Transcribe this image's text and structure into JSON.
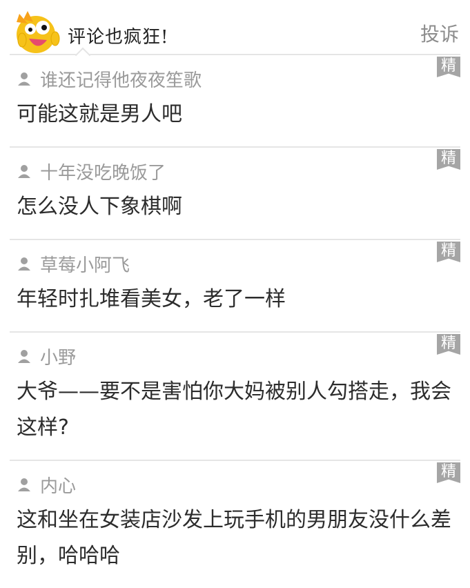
{
  "header": {
    "title": "评论也疯狂!",
    "report_label": "投诉"
  },
  "badge_label": "精",
  "comments": [
    {
      "user": "谁还记得他夜夜笙歌",
      "text": "可能这就是男人吧"
    },
    {
      "user": "十年没吃晚饭了",
      "text": "怎么没人下象棋啊"
    },
    {
      "user": "草莓小阿飞",
      "text": "年轻时扎堆看美女，老了一样"
    },
    {
      "user": "小野",
      "text": "大爷——要不是害怕你大妈被别人勾搭走，我会这样?"
    },
    {
      "user": "内心",
      "text": "这和坐在女装店沙发上玩手机的男朋友没什么差别，哈哈哈"
    }
  ],
  "colors": {
    "mascot": "#f6c21a",
    "badge": "#a5a5a5",
    "username": "#9a9a9a",
    "divider": "#e5e5e5"
  }
}
